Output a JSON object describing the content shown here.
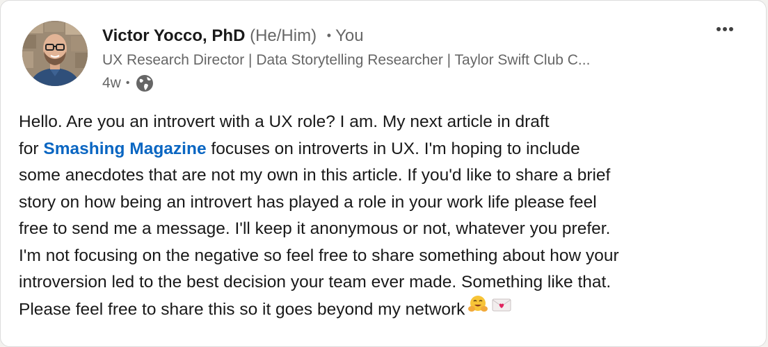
{
  "author": {
    "name": "Victor Yocco, PhD",
    "pronouns": "(He/Him)",
    "separator": "•",
    "relation": "You",
    "headline": "UX Research Director | Data Storytelling Researcher | Taylor Swift Club C...",
    "time_ago": "4w",
    "meta_separator": "•",
    "visibility_icon": "globe-icon"
  },
  "menu": {
    "icon": "more-options-icon",
    "label": "•••"
  },
  "post": {
    "line1": "Hello. Are you an introvert with a UX role? I am. My next article in draft",
    "line2_prefix": "for ",
    "link_text": "Smashing Magazine",
    "line2_suffix": " focuses on introverts in UX. I'm hoping to include",
    "line3": "some anecdotes that are not my own in this article. If you'd like to share a brief",
    "line4": "story on how being an introvert has played a role in your work life please feel",
    "line5": "free to send me a message. I'll keep it anonymous or not, whatever you prefer.",
    "line6": "I'm not focusing on the negative so feel free to share something about how your",
    "line7": "introversion led to the best decision your team ever made. Something like that.",
    "line8": "Please feel free to share this so it goes beyond my network",
    "emojis": [
      "hugging-face-emoji",
      "love-letter-emoji"
    ]
  },
  "colors": {
    "link": "#0a66c2",
    "text": "#191919",
    "secondary": "#666666"
  }
}
